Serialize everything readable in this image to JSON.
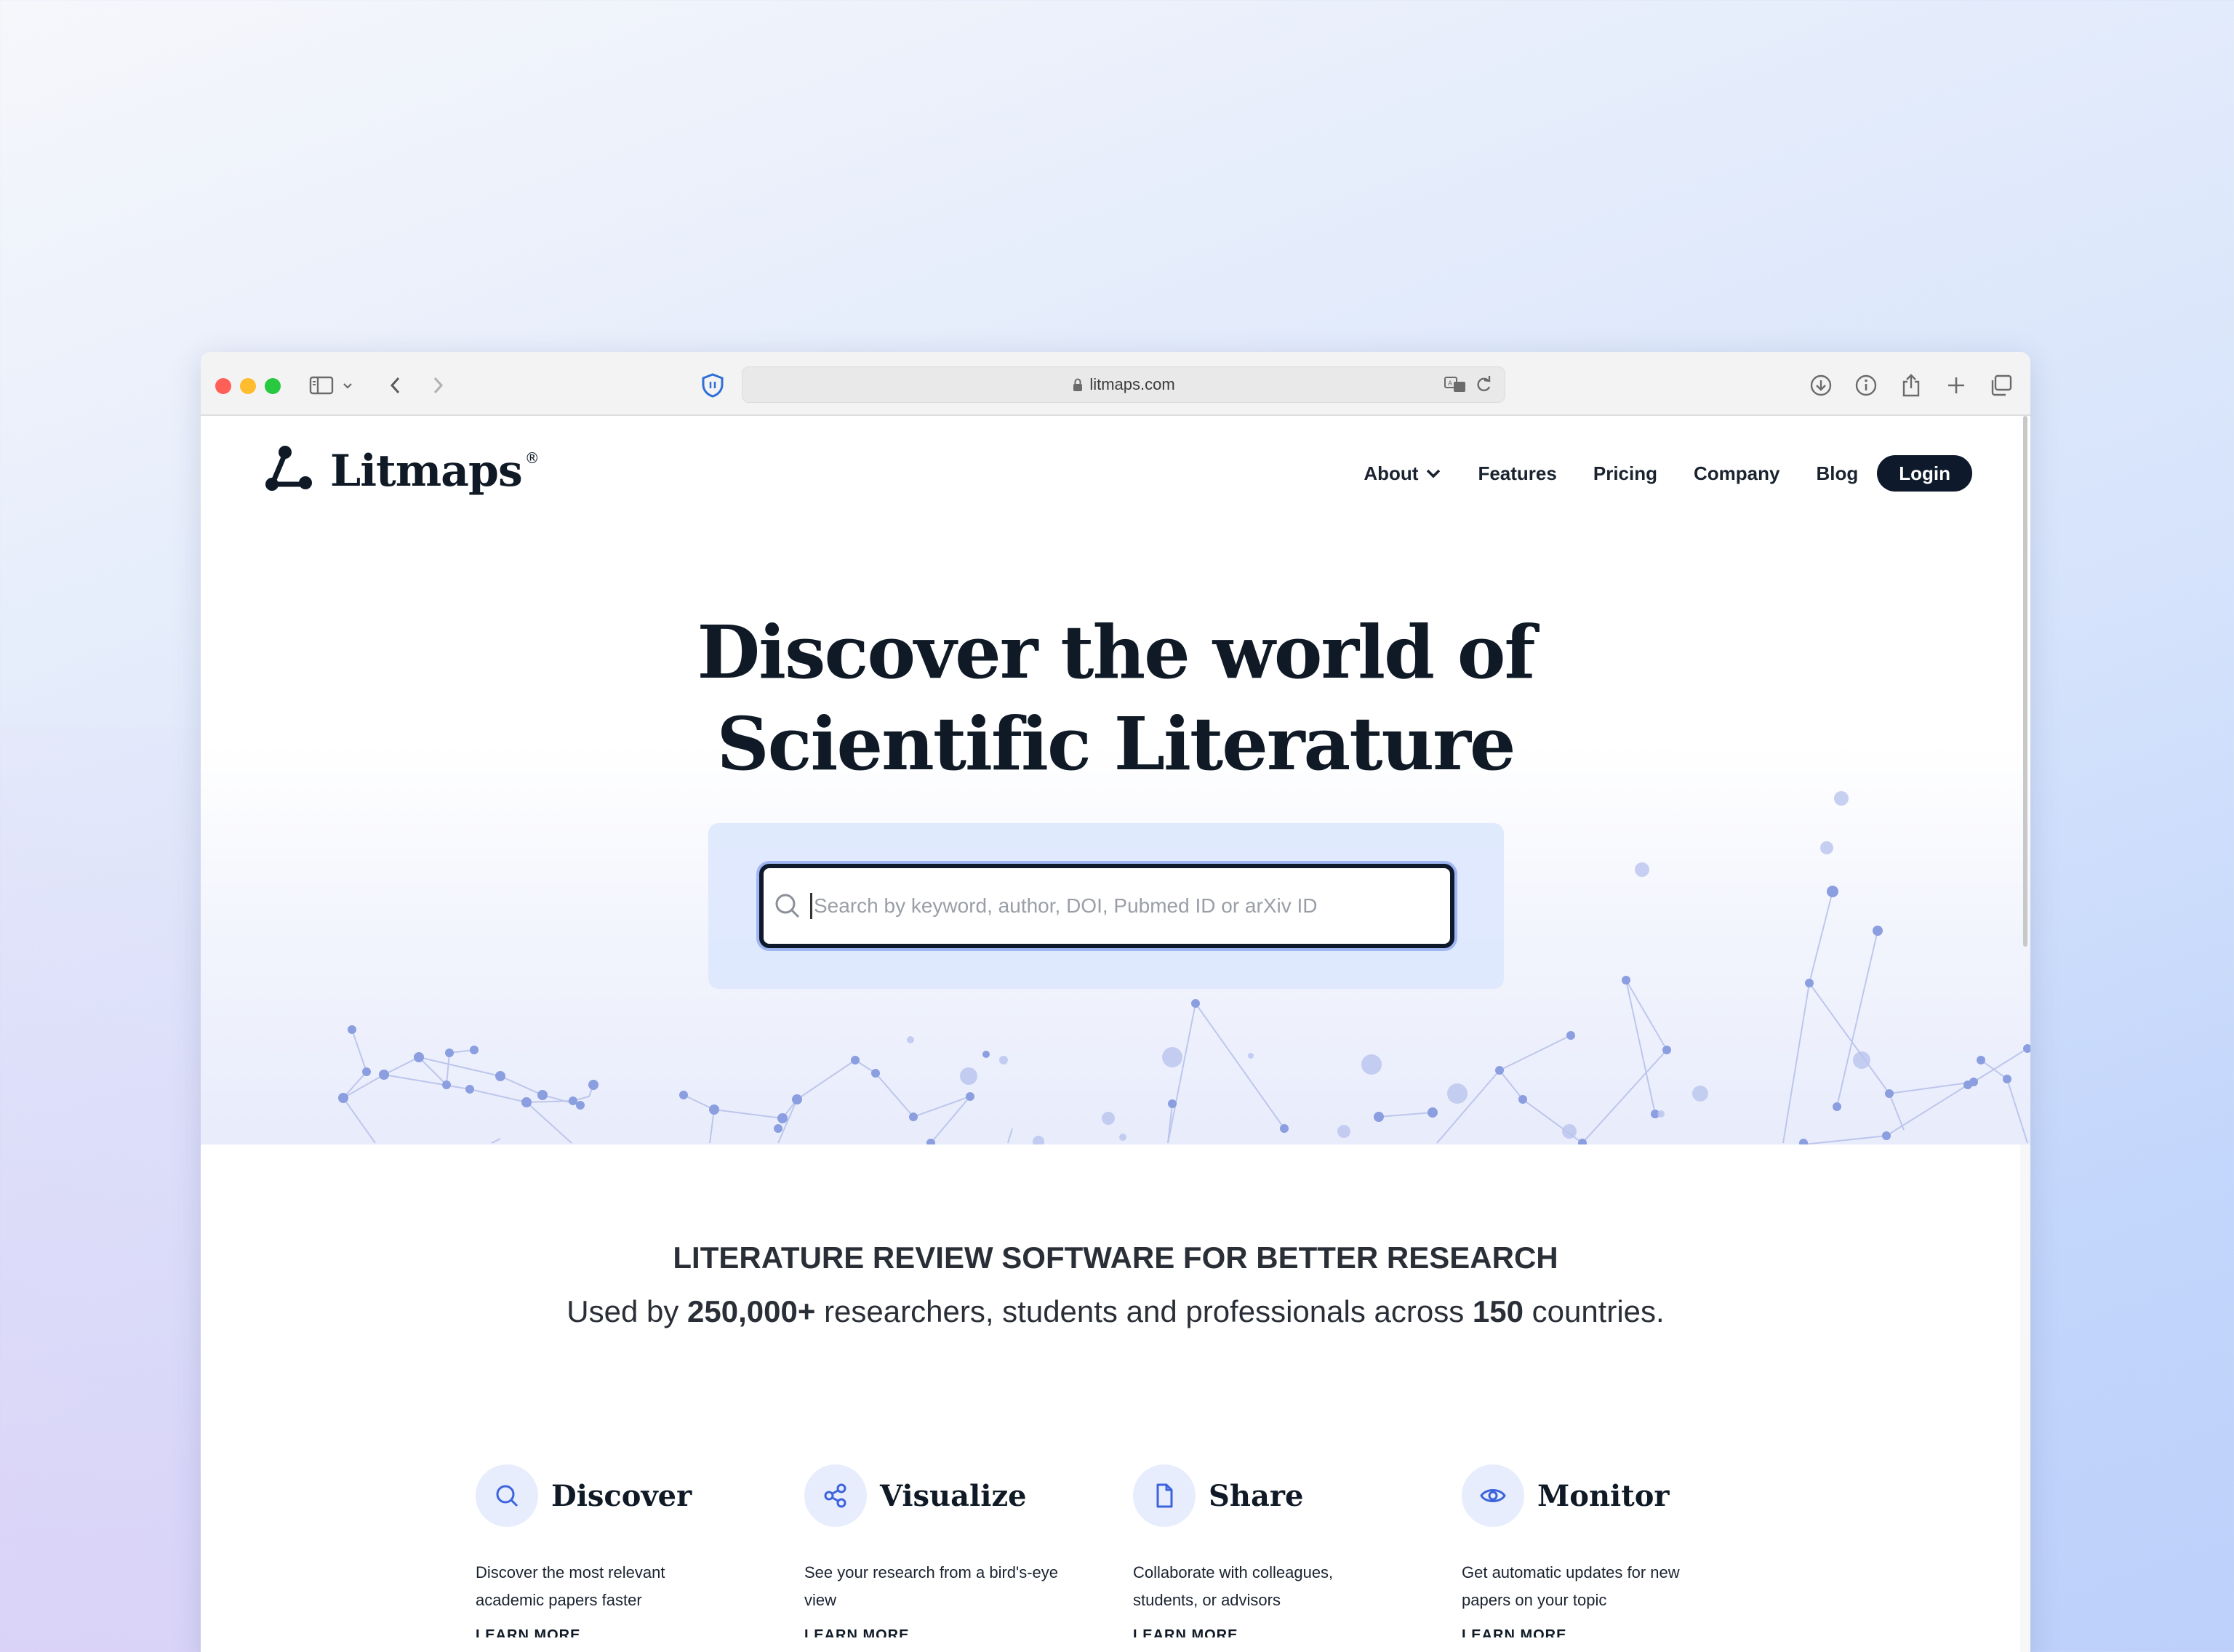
{
  "browser": {
    "url": "litmaps.com"
  },
  "nav": {
    "brand": "Litmaps",
    "brand_mark": "®",
    "links": [
      "About",
      "Features",
      "Pricing",
      "Company",
      "Blog"
    ],
    "login": "Login"
  },
  "hero": {
    "title_line1": "Discover the world of",
    "title_line2": "Scientific Literature",
    "search_placeholder": "Search by keyword, author, DOI, Pubmed ID or arXiv ID"
  },
  "stats": {
    "tagline": "LITERATURE REVIEW SOFTWARE FOR BETTER RESEARCH",
    "used_prefix": "Used by ",
    "users": "250,000+",
    "used_middle": " researchers, students and professionals across ",
    "countries": "150",
    "used_suffix": " countries."
  },
  "features": [
    {
      "title": "Discover",
      "icon": "search-icon",
      "desc": "Discover the most relevant academic papers faster",
      "more": "LEARN MORE"
    },
    {
      "title": "Visualize",
      "icon": "share-nodes-icon",
      "desc": "See your research from a bird's-eye view",
      "more": "LEARN MORE"
    },
    {
      "title": "Share",
      "icon": "document-icon",
      "desc": "Collaborate with colleagues, students, or advisors",
      "more": "LEARN MORE"
    },
    {
      "title": "Monitor",
      "icon": "eye-icon",
      "desc": "Get automatic updates for new papers on your topic",
      "more": "LEARN MORE"
    }
  ],
  "colors": {
    "brand_dark": "#0e1a2b",
    "accent_blue": "#3d63dd",
    "panel_blue": "#dce6fd",
    "node_blue": "#8a9ee0"
  }
}
